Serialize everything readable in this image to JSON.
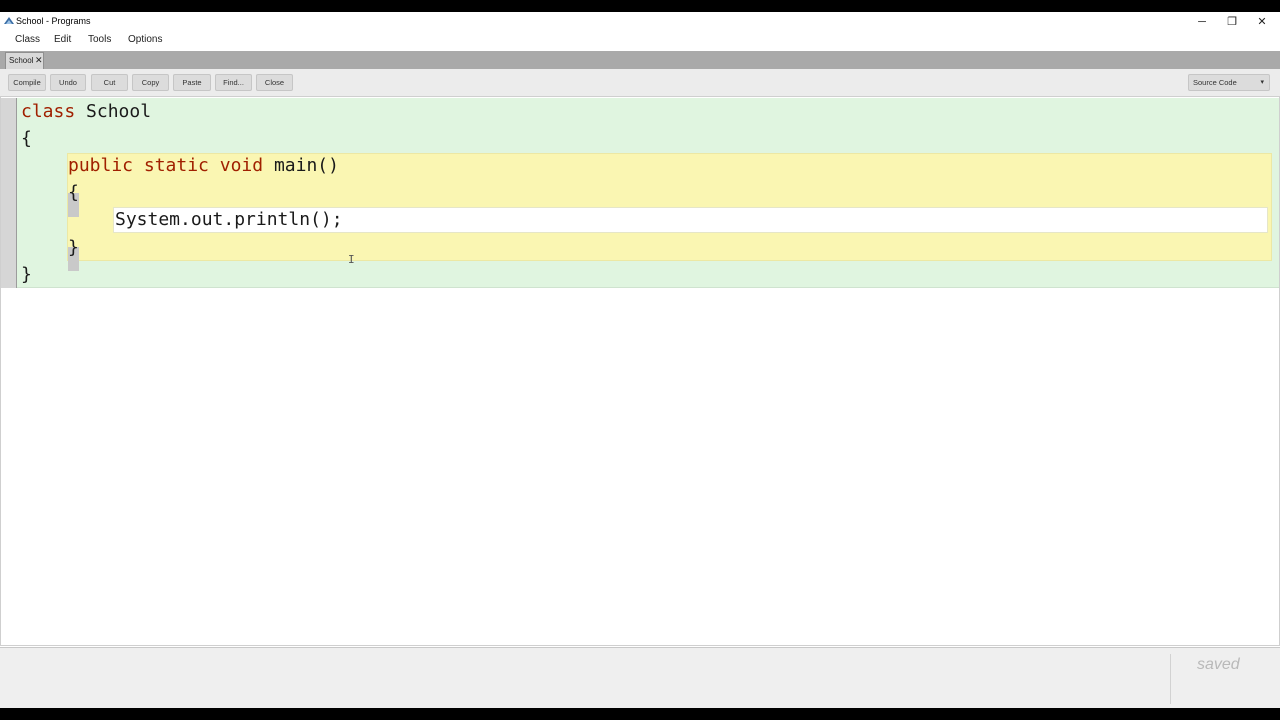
{
  "window": {
    "title": "School - Programs",
    "controls": {
      "minimize": "─",
      "maximize": "❐",
      "close": "✕"
    }
  },
  "menu": [
    "Class",
    "Edit",
    "Tools",
    "Options"
  ],
  "tabs": [
    {
      "label": "School",
      "close": "✕"
    }
  ],
  "toolbar": {
    "buttons": [
      "Compile",
      "Undo",
      "Cut",
      "Copy",
      "Paste",
      "Find...",
      "Close"
    ],
    "view_select": "Source Code",
    "view_caret": "▾"
  },
  "editor": {
    "lines": {
      "line1_kw": "class",
      "line1_name": "School",
      "line2": "{",
      "line3_kw1": "public",
      "line3_kw2": "static",
      "line3_kw3": "void",
      "line3_rest": "main()",
      "line4": "{",
      "line5": "System.out.println();",
      "line6": "}",
      "line7": "}"
    },
    "colors": {
      "class_scope": "#e0f5e0",
      "method_scope": "#faf6b2",
      "keyword": "#a02000"
    }
  },
  "status": {
    "text": "saved"
  }
}
